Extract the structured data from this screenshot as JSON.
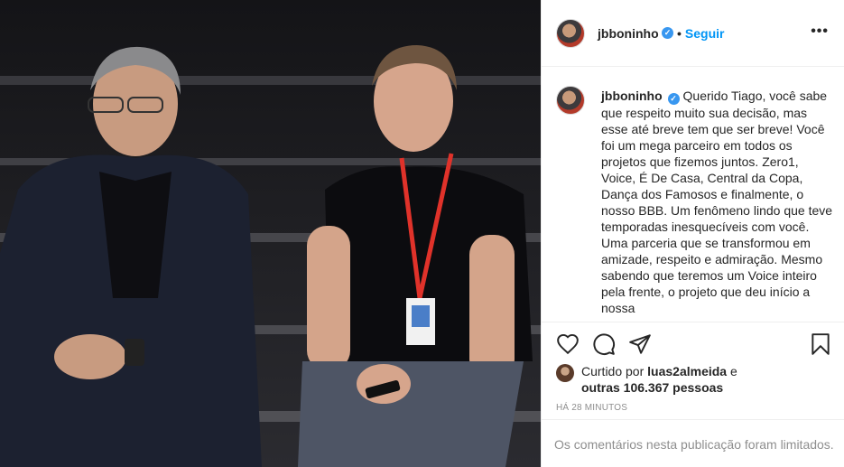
{
  "post": {
    "username": "jbboninho",
    "follow_label": "Seguir",
    "more_label": "•••",
    "verified_mark": "✓",
    "separator": "•"
  },
  "caption": {
    "username": "jbboninho",
    "text": "Querido Tiago, você sabe que respeito muito sua decisão, mas esse até breve tem que ser breve! Você foi um mega parceiro em todos os projetos que fizemos juntos. Zero1, Voice, É De Casa, Central da Copa, Dança dos Famosos e finalmente, o nosso BBB. Um fenômeno lindo que teve temporadas inesquecíveis com você. Uma parceria que se transformou em amizade, respeito e admiração. Mesmo sabendo que teremos um Voice inteiro pela frente, o projeto que deu início a nossa"
  },
  "likes": {
    "prefix": "Curtido por",
    "user": "luas2almeida",
    "connector": "e",
    "others": "outras 106.367 pessoas"
  },
  "timestamp": "HÁ 28 MINUTOS",
  "comments_limited": "Os comentários nesta publicação foram limitados.",
  "icons": {
    "like": "heart-icon",
    "comment": "comment-icon",
    "share": "paper-plane-icon",
    "save": "bookmark-icon"
  },
  "colors": {
    "link": "#0095f6",
    "verified": "#3897f0",
    "muted": "#8e8e8e",
    "text": "#262626"
  }
}
